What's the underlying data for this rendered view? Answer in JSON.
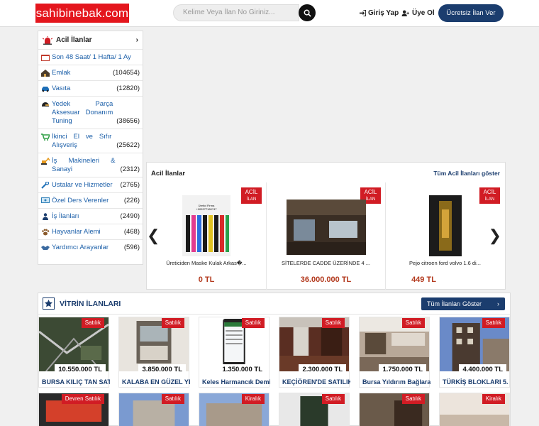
{
  "header": {
    "logo": "sahibinebak.com",
    "search_placeholder": "Kelime Veya İlan No Giriniz...",
    "login": "Giriş Yap",
    "register": "Üye Ol",
    "post_ad": "Ücretsiz İlan Ver"
  },
  "sidebar": {
    "title": "Acil İlanlar",
    "items": [
      {
        "label": "Son 48 Saat/ 1 Hafta/ 1 Ay",
        "count": ""
      },
      {
        "label": "Emlak",
        "count": "(104654)"
      },
      {
        "label": "Vasıta",
        "count": "(12820)"
      },
      {
        "label": "Yedek Parça Aksesuar Donanım Tuning",
        "count": "(38656)"
      },
      {
        "label": "İkinci El ve Sıfır Alışveriş",
        "count": "(25622)"
      },
      {
        "label": "İş Makineleri & Sanayi",
        "count": "(2312)"
      },
      {
        "label": "Ustalar ve Hizmetler",
        "count": "(2765)"
      },
      {
        "label": "Özel Ders Verenler",
        "count": "(226)"
      },
      {
        "label": "İş İlanları",
        "count": "(2490)"
      },
      {
        "label": "Hayvanlar Alemi",
        "count": "(468)"
      },
      {
        "label": "Yardımcı Arayanlar",
        "count": "(596)"
      }
    ]
  },
  "acil": {
    "title": "Acil İlanlar",
    "show_all": "Tüm Acil İlanları göster",
    "badge_main": "ACİL",
    "badge_sub": "İLAN",
    "cards": [
      {
        "name": "Üreticiden Maske Kulak Arkas�...",
        "price": "0 TL",
        "img_text": "Üretici Firma\n+905377180747"
      },
      {
        "name": "SİTELERDE CADDE ÜZERİNDE 4 ...",
        "price": "36.000.000 TL",
        "img_text": ""
      },
      {
        "name": "Pejo citroen ford volvo 1.6 di...",
        "price": "449 TL",
        "img_text": ""
      }
    ]
  },
  "vitrin": {
    "title": "VİTRİN İLANLARI",
    "show_all": "Tüm İlanları Göster",
    "cards": [
      {
        "badge": "Satılık",
        "price": "10.550.000 TL",
        "name": "BURSA KILIÇ TAN SAT"
      },
      {
        "badge": "Satılık",
        "price": "3.850.000 TL",
        "name": "KALABA EN GÜZEL YE"
      },
      {
        "badge": "Satılık",
        "price": "1.350.000 TL",
        "name": "Keles Harmancık Demi"
      },
      {
        "badge": "Satılık",
        "price": "2.300.000 TL",
        "name": "KEÇİÖREN'DE SATILIK"
      },
      {
        "badge": "Satılık",
        "price": "1.750.000 TL",
        "name": "Bursa Yıldırım Bağlara"
      },
      {
        "badge": "Satılık",
        "price": "4.400.000 TL",
        "name": "TÜRKİŞ BLOKLARI 5."
      }
    ],
    "row2_badges": [
      "Devren Satılık",
      "Satılık",
      "Kiralık",
      "Satılık",
      "Satılık",
      "Kiralık"
    ]
  }
}
